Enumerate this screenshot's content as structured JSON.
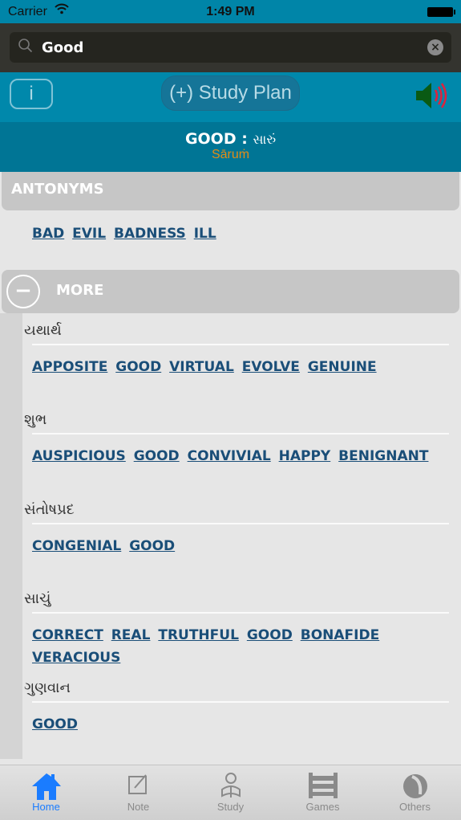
{
  "status_bar": {
    "carrier": "Carrier",
    "time": "1:49 PM"
  },
  "search": {
    "value": "Good",
    "placeholder": ""
  },
  "toolbar": {
    "info_label": "i",
    "study_plan_label": "(+) Study Plan"
  },
  "word": {
    "english": "GOOD",
    "separator": " : ",
    "gujarati": "સારું",
    "transliteration": "Sāruṁ"
  },
  "antonyms": {
    "title": "ANTONYMS",
    "items": [
      "BAD",
      "EVIL",
      "BADNESS",
      "ILL"
    ]
  },
  "more": {
    "title": "MORE",
    "minus": "−",
    "sections": [
      {
        "heading": "યથાર્થ",
        "items": [
          "APPOSITE",
          "GOOD",
          "VIRTUAL",
          "EVOLVE",
          "GENUINE"
        ]
      },
      {
        "heading": "શુભ",
        "items": [
          "AUSPICIOUS",
          "GOOD",
          "CONVIVIAL",
          "HAPPY",
          "BENIGNANT"
        ]
      },
      {
        "heading": "સંતોષપ્રદ",
        "items": [
          "CONGENIAL",
          "GOOD"
        ]
      },
      {
        "heading": "સાચું",
        "items": [
          "CORRECT",
          "REAL",
          "TRUTHFUL",
          "GOOD",
          "BONAFIDE",
          "VERACIOUS"
        ]
      },
      {
        "heading": "ગુણવાન",
        "items": [
          "GOOD"
        ]
      }
    ]
  },
  "tabs": [
    {
      "label": "Home",
      "icon": "home-icon",
      "active": true
    },
    {
      "label": "Note",
      "icon": "note-icon"
    },
    {
      "label": "Study",
      "icon": "study-icon"
    },
    {
      "label": "Games",
      "icon": "abacus-icon"
    },
    {
      "label": "Others",
      "icon": "others-icon"
    }
  ],
  "colors": {
    "accent": "#0088ab",
    "link": "#1a4e78",
    "active_tab": "#1a7cff",
    "transliteration": "#e38d16"
  }
}
